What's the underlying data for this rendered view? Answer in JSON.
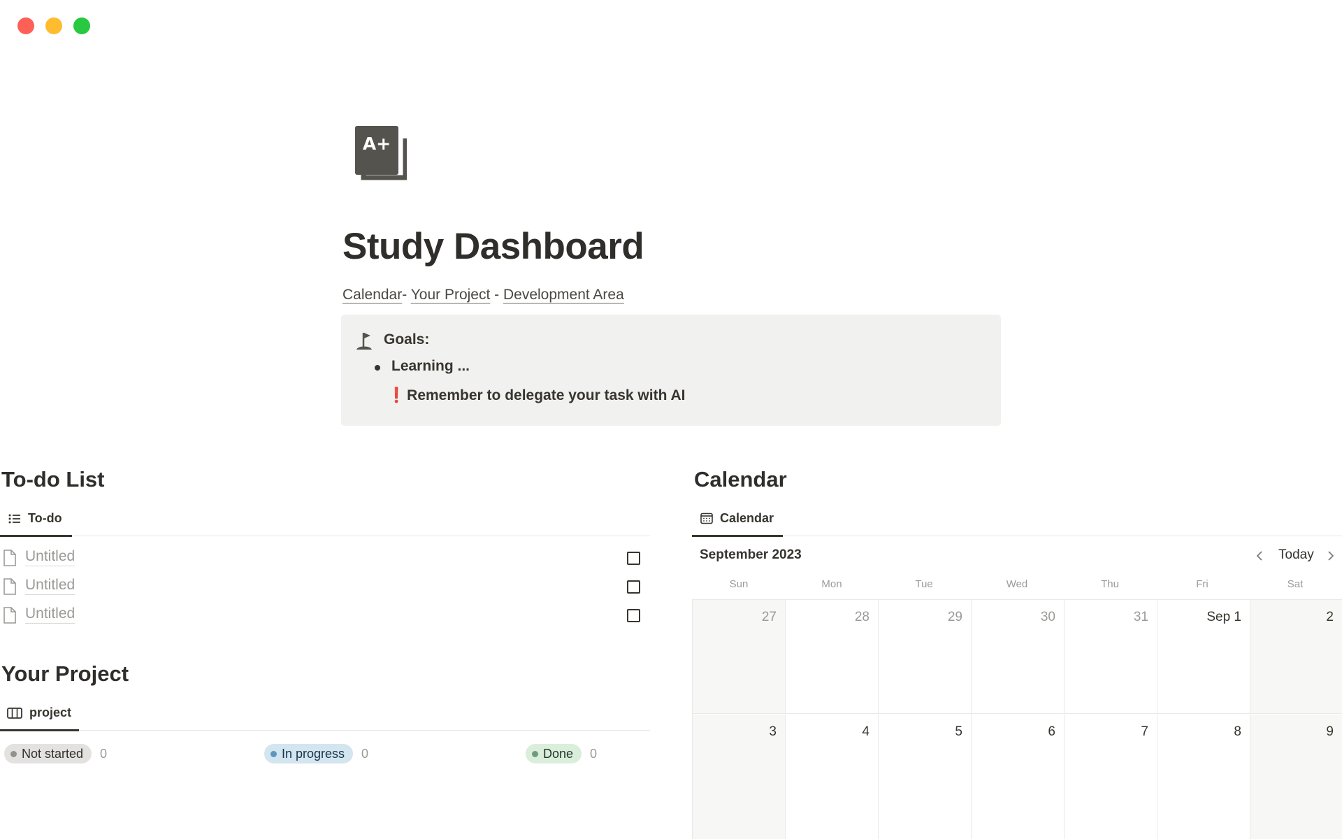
{
  "window": {
    "controls": [
      "close",
      "minimize",
      "zoom"
    ]
  },
  "page": {
    "icon": "a-plus-document-icon",
    "title": "Study Dashboard",
    "links": [
      {
        "label": "Calendar"
      },
      {
        "separator": "- "
      },
      {
        "label": "Your Project"
      },
      {
        "separator": " - "
      },
      {
        "label": "Development Area"
      }
    ]
  },
  "callout": {
    "icon": "golf-flag-icon",
    "heading": "Goals:",
    "bullet": "Learning ...",
    "reminder_mark": "❗",
    "reminder": "Remember to delegate your task with AI"
  },
  "todo": {
    "heading": "To-do List",
    "view_label": "To-do",
    "view_icon": "list-icon",
    "items": [
      {
        "name": "Untitled",
        "checked": false
      },
      {
        "name": "Untitled",
        "checked": false
      },
      {
        "name": "Untitled",
        "checked": false
      }
    ]
  },
  "project": {
    "heading": "Your Project",
    "view_label": "project",
    "view_icon": "board-icon",
    "groups": [
      {
        "label": "Not started",
        "count": "0",
        "bg": "#e3e2e0",
        "dot": "#91918e",
        "color": "#32302c"
      },
      {
        "label": "In progress",
        "count": "0",
        "bg": "#d3e5ef",
        "dot": "#5b97bd",
        "color": "#183347"
      },
      {
        "label": "Done",
        "count": "0",
        "bg": "#dbeddb",
        "dot": "#6c9b7d",
        "color": "#1c3829"
      }
    ]
  },
  "calendar": {
    "heading": "Calendar",
    "view_label": "Calendar",
    "view_icon": "calendar-icon",
    "month": "September 2023",
    "today_label": "Today",
    "weekdays": [
      "Sun",
      "Mon",
      "Tue",
      "Wed",
      "Thu",
      "Fri",
      "Sat"
    ],
    "weeks": [
      [
        {
          "day": "27",
          "out": true
        },
        {
          "day": "28",
          "out": true
        },
        {
          "day": "29",
          "out": true
        },
        {
          "day": "30",
          "out": true
        },
        {
          "day": "31",
          "out": true
        },
        {
          "day": "Sep 1",
          "out": false
        },
        {
          "day": "2",
          "out": false
        }
      ],
      [
        {
          "day": "3",
          "out": false
        },
        {
          "day": "4",
          "out": false
        },
        {
          "day": "5",
          "out": false
        },
        {
          "day": "6",
          "out": false
        },
        {
          "day": "7",
          "out": false
        },
        {
          "day": "8",
          "out": false
        },
        {
          "day": "9",
          "out": false
        }
      ]
    ]
  }
}
